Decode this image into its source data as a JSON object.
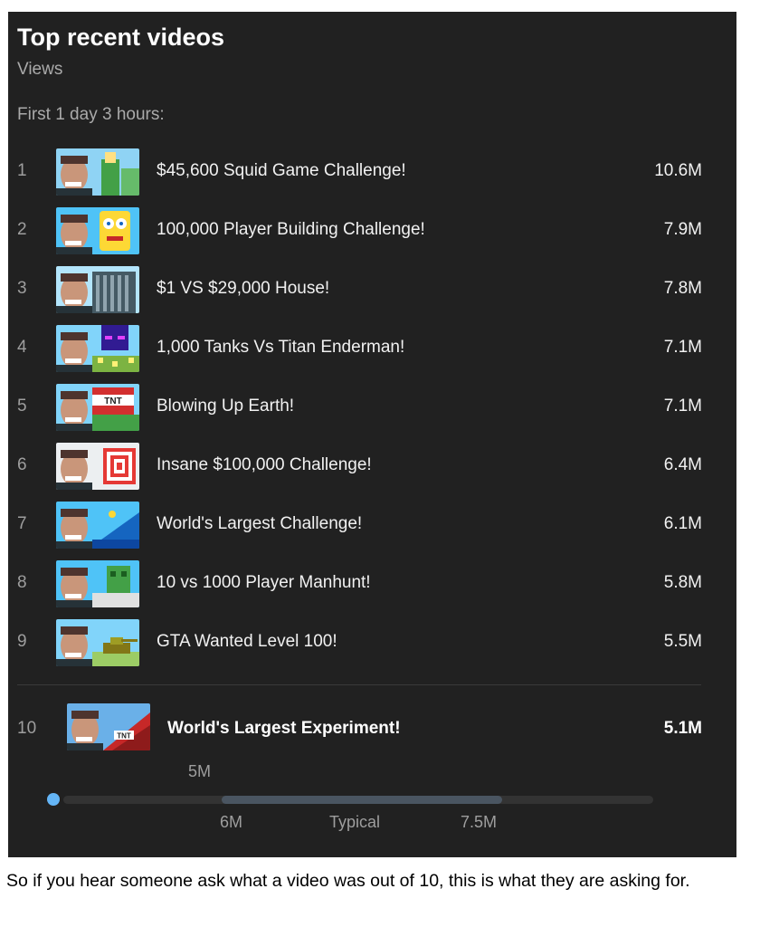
{
  "card": {
    "title": "Top recent videos",
    "subtitle": "Views",
    "period": "First 1 day 3 hours:"
  },
  "videos": [
    {
      "rank": "1",
      "title": "$45,600 Squid Game Challenge!",
      "views": "10.6M",
      "thumb_icon": "squid-game-thumbnail-icon"
    },
    {
      "rank": "2",
      "title": "100,000 Player Building Challenge!",
      "views": "7.9M",
      "thumb_icon": "spongebob-thumbnail-icon"
    },
    {
      "rank": "3",
      "title": "$1 VS $29,000 House!",
      "views": "7.8M",
      "thumb_icon": "house-thumbnail-icon"
    },
    {
      "rank": "4",
      "title": "1,000 Tanks Vs Titan Enderman!",
      "views": "7.1M",
      "thumb_icon": "enderman-thumbnail-icon"
    },
    {
      "rank": "5",
      "title": "Blowing Up Earth!",
      "views": "7.1M",
      "thumb_icon": "tnt-thumbnail-icon",
      "thumb_text": "TNT"
    },
    {
      "rank": "6",
      "title": "Insane $100,000 Challenge!",
      "views": "6.4M",
      "thumb_icon": "target-thumbnail-icon"
    },
    {
      "rank": "7",
      "title": "World's Largest Challenge!",
      "views": "6.1M",
      "thumb_icon": "hill-thumbnail-icon"
    },
    {
      "rank": "8",
      "title": "10 vs 1000 Player Manhunt!",
      "views": "5.8M",
      "thumb_icon": "manhunt-thumbnail-icon"
    },
    {
      "rank": "9",
      "title": "GTA Wanted Level 100!",
      "views": "5.5M",
      "thumb_icon": "tank-thumbnail-icon"
    }
  ],
  "current": {
    "rank": "10",
    "title": "World's Largest Experiment!",
    "views": "5.1M",
    "thumb_icon": "tnt-wall-thumbnail-icon",
    "thumb_text": "TNT"
  },
  "range": {
    "current_label": "5M",
    "low_label": "6M",
    "typical_label": "Typical",
    "high_label": "7.5M",
    "current_value": 5.1,
    "typical_low": 6.0,
    "typical_high": 7.5
  },
  "caption": "So if you hear someone ask what a video was out of 10, this is what they are asking for.",
  "colors": {
    "card_bg": "#212121",
    "typical_band": "#4a5561",
    "current_dot": "#64b5f6"
  }
}
